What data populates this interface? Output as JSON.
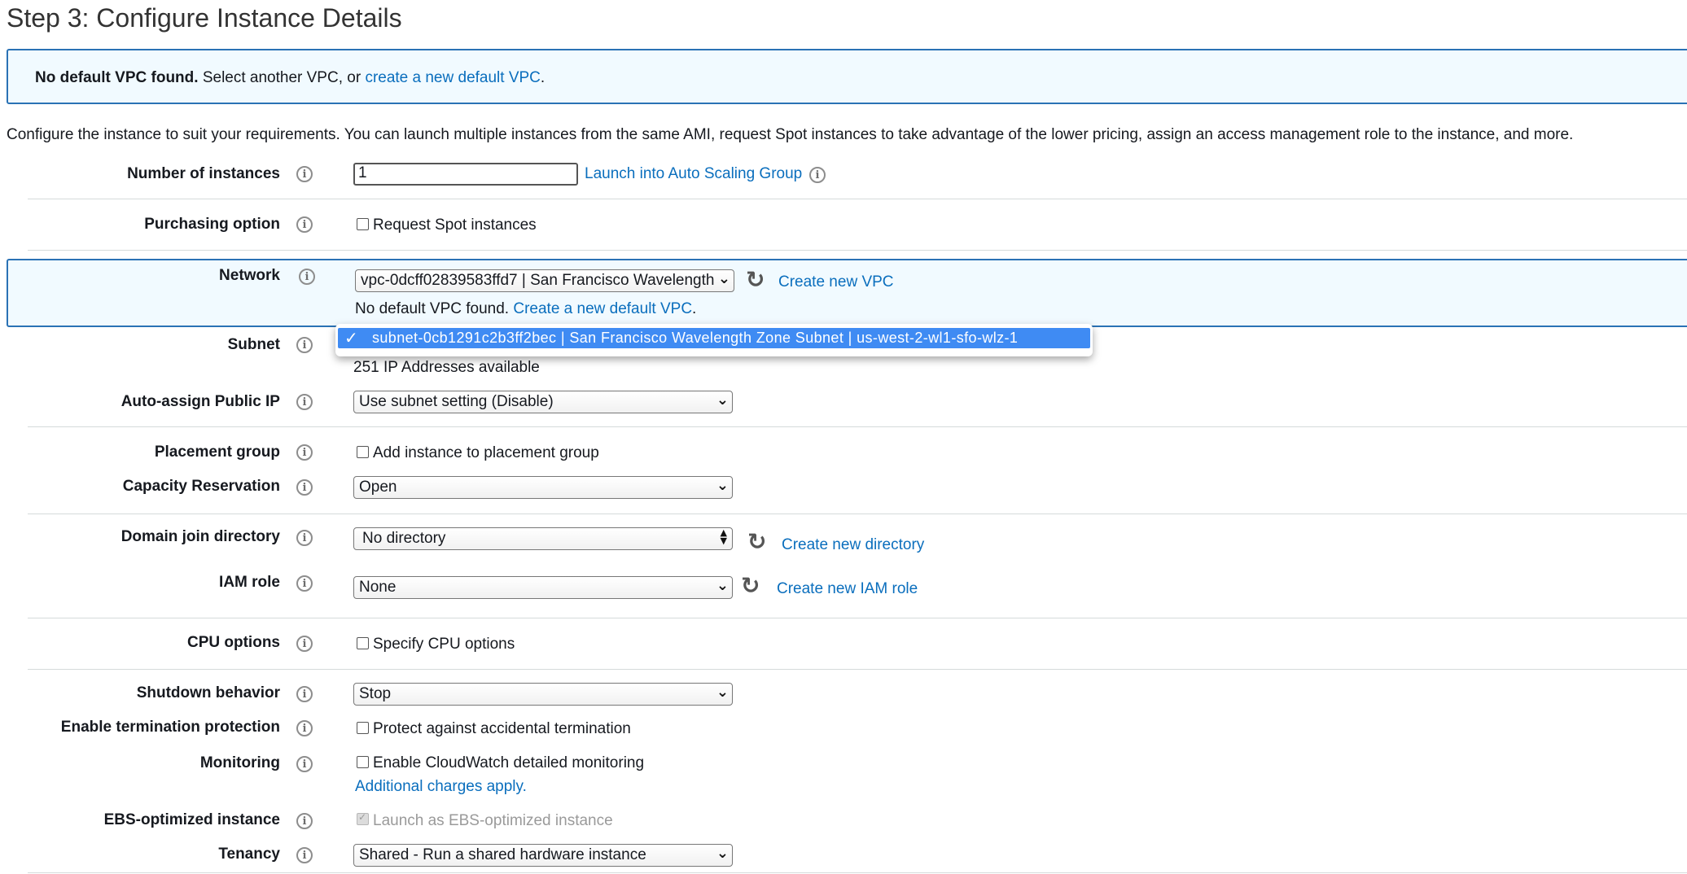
{
  "page_title": "Step 3: Configure Instance Details",
  "alert": {
    "bold": "No default VPC found.",
    "text": " Select another VPC, or ",
    "link": "create a new default VPC",
    "end": "."
  },
  "intro": "Configure the instance to suit your requirements. You can launch multiple instances from the same AMI, request Spot instances to take advantage of the lower pricing, assign an access management role to the instance, and more.",
  "fields": {
    "num_instances": {
      "label": "Number of instances",
      "value": "1",
      "link": "Launch into Auto Scaling Group"
    },
    "purchasing": {
      "label": "Purchasing option",
      "checkbox": "Request Spot instances"
    },
    "network": {
      "label": "Network",
      "value": "vpc-0dcff02839583ffd7 | San Francisco Wavelength",
      "link": "Create new VPC",
      "note": "No default VPC found.",
      "note_link": "Create a new default VPC",
      "note_end": "."
    },
    "subnet": {
      "label": "Subnet",
      "selected_option": "subnet-0cb1291c2b3ff2bec | San Francisco Wavelength Zone Subnet | us-west-2-wl1-sfo-wlz-1",
      "available": "251 IP Addresses available"
    },
    "public_ip": {
      "label": "Auto-assign Public IP",
      "value": "Use subnet setting (Disable)"
    },
    "placement": {
      "label": "Placement group",
      "checkbox": "Add instance to placement group"
    },
    "capacity": {
      "label": "Capacity Reservation",
      "value": "Open"
    },
    "domain": {
      "label": "Domain join directory",
      "value": "No directory",
      "link": "Create new directory"
    },
    "iam": {
      "label": "IAM role",
      "value": "None",
      "link": "Create new IAM role"
    },
    "cpu": {
      "label": "CPU options",
      "checkbox": "Specify CPU options"
    },
    "shutdown": {
      "label": "Shutdown behavior",
      "value": "Stop"
    },
    "termination": {
      "label": "Enable termination protection",
      "checkbox": "Protect against accidental termination"
    },
    "monitoring": {
      "label": "Monitoring",
      "checkbox": "Enable CloudWatch detailed monitoring",
      "link": "Additional charges apply."
    },
    "ebs": {
      "label": "EBS-optimized instance",
      "checkbox": "Launch as EBS-optimized instance",
      "checked": true,
      "disabled": true
    },
    "tenancy": {
      "label": "Tenancy",
      "value": "Shared - Run a shared hardware instance"
    }
  },
  "icons": {
    "info": "info-icon",
    "refresh": "refresh-icon",
    "chevron": "chevron-down-icon",
    "check": "check-icon"
  },
  "colors": {
    "link": "#0a6ebd",
    "alert_border": "#2a72b5",
    "alert_bg": "#f1faff",
    "dropdown_highlight": "#3f8bf3"
  }
}
